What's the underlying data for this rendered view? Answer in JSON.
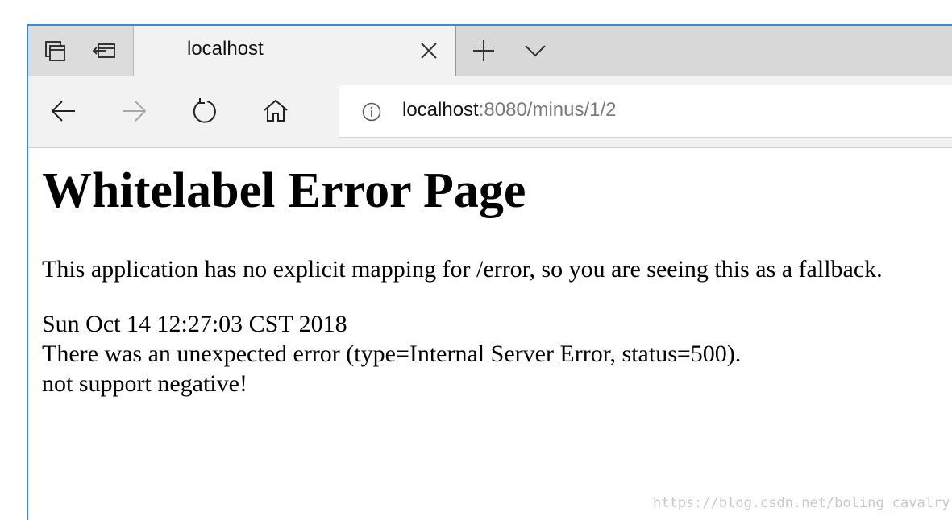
{
  "browser": {
    "tab": {
      "title": "localhost",
      "close_icon": "close-icon"
    },
    "tab_actions": [
      "set-aside-tabs-icon",
      "show-tabs-aside-icon"
    ],
    "new_tab_icon": "plus-icon",
    "tab_preview_icon": "chevron-down-icon",
    "nav": {
      "back_icon": "back-arrow-icon",
      "forward_icon": "forward-arrow-icon",
      "refresh_icon": "refresh-icon",
      "home_icon": "home-icon"
    },
    "address": {
      "info_icon": "info-icon",
      "host": "localhost",
      "rest": ":8080/minus/1/2"
    },
    "colors": {
      "accent_border": "#3a8ad6",
      "tabbar_bg": "#d8d8d8",
      "active_tab_bg": "#f2f2f2"
    }
  },
  "page": {
    "title": "Whitelabel Error Page",
    "description": "This application has no explicit mapping for /error, so you are seeing this as a fallback.",
    "timestamp": "Sun Oct 14 12:27:03 CST 2018",
    "error_line": "There was an unexpected error (type=Internal Server Error, status=500).",
    "message": "not support negative!"
  },
  "watermark": "https://blog.csdn.net/boling_cavalry"
}
